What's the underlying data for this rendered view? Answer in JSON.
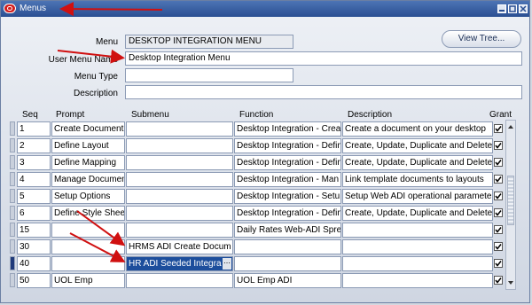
{
  "window": {
    "title": "Menus"
  },
  "header": {
    "menu_label": "Menu",
    "menu_value": "DESKTOP INTEGRATION MENU",
    "user_menu_label": "User Menu Name",
    "user_menu_value": "Desktop Integration Menu",
    "menu_type_label": "Menu Type",
    "menu_type_value": "",
    "description_label": "Description",
    "description_value": "",
    "view_tree_label": "View Tree..."
  },
  "table": {
    "columns": [
      "Seq",
      "Prompt",
      "Submenu",
      "Function",
      "Description",
      "Grant"
    ],
    "rows": [
      {
        "seq": "1",
        "prompt": "Create Document",
        "submenu": "",
        "function": "Desktop Integration - Crea",
        "description": "Create a document on your desktop",
        "grant": true
      },
      {
        "seq": "2",
        "prompt": "Define Layout",
        "submenu": "",
        "function": "Desktop Integration - Defin",
        "description": "Create, Update, Duplicate and Delete",
        "grant": true
      },
      {
        "seq": "3",
        "prompt": "Define Mapping",
        "submenu": "",
        "function": "Desktop Integration - Defin",
        "description": "Create, Update, Duplicate and Delete",
        "grant": true
      },
      {
        "seq": "4",
        "prompt": "Manage Documen",
        "submenu": "",
        "function": "Desktop Integration - Man",
        "description": "Link template documents to layouts",
        "grant": true
      },
      {
        "seq": "5",
        "prompt": "Setup Options",
        "submenu": "",
        "function": "Desktop Integration - Setu",
        "description": "Setup Web ADI operational paramete",
        "grant": true
      },
      {
        "seq": "6",
        "prompt": "Define Style Shee",
        "submenu": "",
        "function": "Desktop Integration - Defin",
        "description": "Create, Update, Duplicate and Delete",
        "grant": true
      },
      {
        "seq": "15",
        "prompt": "",
        "submenu": "",
        "function": "Daily Rates Web-ADI Spre",
        "description": "",
        "grant": true
      },
      {
        "seq": "30",
        "prompt": "",
        "submenu": "HRMS ADI Create Docum",
        "function": "",
        "description": "",
        "grant": true
      },
      {
        "seq": "40",
        "prompt": "",
        "submenu": "HR ADI Seeded Integra",
        "function": "",
        "description": "",
        "grant": true
      },
      {
        "seq": "50",
        "prompt": "UOL Emp",
        "submenu": "",
        "function": "UOL Emp ADI",
        "description": "",
        "grant": true
      }
    ]
  }
}
